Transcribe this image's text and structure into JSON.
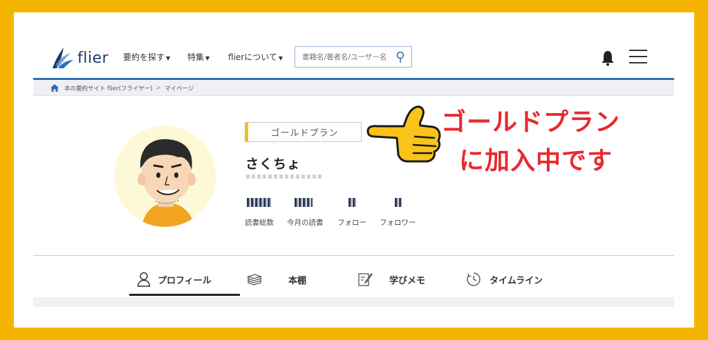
{
  "header": {
    "logo_text": "flier",
    "nav": [
      {
        "label": "要約を探す"
      },
      {
        "label": "特集"
      },
      {
        "label": "flierについて"
      }
    ],
    "search": {
      "placeholder": "書籍名/著者名/ユーザー名"
    }
  },
  "breadcrumb": {
    "items": [
      "本の要約サイト flier(フライヤー)",
      "マイページ"
    ]
  },
  "profile": {
    "plan_badge": "ゴールドプラン",
    "name": "さくちょ",
    "stats": [
      {
        "label": "読書総数"
      },
      {
        "label": "今月の読書"
      },
      {
        "label": "フォロー"
      },
      {
        "label": "フォロワー"
      }
    ]
  },
  "callout": {
    "line1": "ゴールドプラン",
    "line2": "に加入中です"
  },
  "tabs": [
    {
      "label": "プロフィール",
      "active": true,
      "icon": "user-icon"
    },
    {
      "label": "本棚",
      "active": false,
      "icon": "books-icon"
    },
    {
      "label": "学びメモ",
      "active": false,
      "icon": "memo-icon"
    },
    {
      "label": "タイムライン",
      "active": false,
      "icon": "clock-icon"
    }
  ],
  "colors": {
    "frame": "#f5b400",
    "header_border": "#2f6fb5",
    "callout": "#e8292e",
    "plan_accent": "#e6c02e"
  }
}
